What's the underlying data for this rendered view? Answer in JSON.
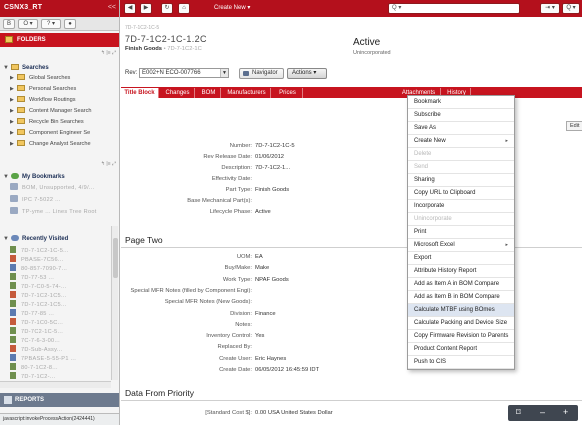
{
  "brand": {
    "name": "CSNX3_RT",
    "collapse": "<<"
  },
  "left_toolbar": {
    "btn1": "B",
    "btn2": "O ▾",
    "btn3": "? ▾",
    "btn4": "●"
  },
  "folders": {
    "label": "FOLDERS",
    "tools": "↰  |≡  ⤢"
  },
  "searches": {
    "title": "Searches",
    "items": [
      "Global Searches",
      "Personal Searches",
      "Workflow Routings",
      "Content Manager Search",
      "Recycle Bin Searches",
      "Component Engineer Se",
      "Change Analyst Searche"
    ],
    "tools": "↰  |≡  ⤢"
  },
  "bookmarks": {
    "title": "My Bookmarks",
    "items": [
      "BOM, Unsupported, 4/9/...",
      "IPC 7-5022 ...",
      "TP-yme ... Lines Tree Root"
    ]
  },
  "recent": {
    "title": "Recently Visited",
    "items": [
      "7D-7-1C2-1C-5...",
      "PBASE-7C56...",
      "80-857-7090-7...",
      "7D-77-53 ...",
      "7D-7-C0-5-74-...",
      "7D-7-1C2-1C5...",
      "7D-7-1C2-1C5...",
      "7D-77-85 ...",
      "7D-7-1C0-5C...",
      "7D-7C2-1C-5...",
      "7C-7-6-3-00...",
      "7D-Sub-Assy...",
      "7PBASE-5-55-P1 ...",
      "80-7-1C2-8...",
      "7D-7-1C2-..."
    ]
  },
  "reports": {
    "label": "REPORTS"
  },
  "status_url": "javascript:invokeProcessAction(2424441)",
  "topbar": {
    "back": "◀",
    "forward": "▶",
    "refresh": "↻",
    "home": "⌂",
    "create_new": "Create New ▾",
    "search_placeholder": "Q ▾",
    "btn_go": "⇥ ▾",
    "btn_adv": "Q ▾"
  },
  "object": {
    "number_header": "7D-7-1C2-1C-5",
    "name": "7D-7-1C2-1C-1.2C",
    "type_label": "Finish Goods",
    "type_suffix": "• 7D-7-1C2-1C",
    "state": "Active",
    "substate": "Unincorporated",
    "rev_label": "Rev:",
    "rev_value": "E002+N        ECO-007766",
    "navigator": "Navigator",
    "actions": "Actions ▾"
  },
  "tabs": [
    "Title Block",
    "Changes",
    "BOM",
    "Manufacturers",
    "Prices",
    "Attachments",
    "History"
  ],
  "edit_label": "Edit",
  "title_fields": [
    {
      "label": "Number:",
      "value": "7D-7-1C2-1C-5"
    },
    {
      "label": "Rev Release Date:",
      "value": "01/06/2012"
    },
    {
      "label": "Description:",
      "value": "7D-7-1C2-1..."
    },
    {
      "label": "Effectivity Date:",
      "value": ""
    },
    {
      "label": "Part Type:",
      "value": "Finish Goods"
    },
    {
      "label": "Base Mechanical Part(s):",
      "value": ""
    },
    {
      "label": "Lifecycle Phase:",
      "value": "Active"
    }
  ],
  "page_two": {
    "title": "Page Two",
    "fields": [
      {
        "label": "UOM:",
        "value": "EA"
      },
      {
        "label": "Buy/Make:",
        "value": "Make"
      },
      {
        "label": "Work Type:",
        "value": "NPAF Goods"
      },
      {
        "label": "Special MFR Notes (filled by Component Engi):",
        "value": ""
      },
      {
        "label": "Special MFR Notes (New Goods):",
        "value": ""
      },
      {
        "label": "Division:",
        "value": "Finance"
      },
      {
        "label": "Notes:",
        "value": ""
      },
      {
        "label": "Inventory Control:",
        "value": "Yes"
      },
      {
        "label": "Replaced By:",
        "value": ""
      },
      {
        "label": "Create User:",
        "value": "Eric Haynes"
      },
      {
        "label": "Create Date:",
        "value": "06/05/2012 16:45:59 IDT"
      }
    ]
  },
  "data_from_priority": {
    "title": "Data From Priority",
    "fields": [
      {
        "label": "[Standard Cost $]:",
        "value": "0.00 USA United States Dollar"
      }
    ]
  },
  "actions_menu": {
    "items": [
      {
        "label": "Bookmark",
        "disabled": false,
        "submenu": false
      },
      {
        "label": "Subscribe",
        "disabled": false,
        "submenu": false
      },
      {
        "label": "Save As",
        "disabled": false,
        "submenu": false
      },
      {
        "label": "Create New",
        "disabled": false,
        "submenu": true
      },
      {
        "label": "Delete",
        "disabled": true,
        "submenu": false
      },
      {
        "label": "Send",
        "disabled": true,
        "submenu": false
      },
      {
        "label": "Sharing",
        "disabled": false,
        "submenu": false
      },
      {
        "label": "Copy URL to Clipboard",
        "disabled": false,
        "submenu": false
      },
      {
        "label": "Incorporate",
        "disabled": false,
        "submenu": false
      },
      {
        "label": "Unincorporate",
        "disabled": true,
        "submenu": false
      },
      {
        "label": "Print",
        "disabled": false,
        "submenu": false
      },
      {
        "label": "Microsoft Excel",
        "disabled": false,
        "submenu": true
      },
      {
        "label": "Export",
        "disabled": false,
        "submenu": false
      },
      {
        "label": "Attribute History Report",
        "disabled": false,
        "submenu": false
      },
      {
        "label": "Add as Item A in BOM Compare",
        "disabled": false,
        "submenu": false
      },
      {
        "label": "Add as Item B in BOM Compare",
        "disabled": false,
        "submenu": false
      },
      {
        "label": "Calculate MTBF using BOmes",
        "disabled": false,
        "submenu": false,
        "highlighted": true
      },
      {
        "label": "Calculate Packing and Device Size",
        "disabled": false,
        "submenu": false
      },
      {
        "label": "Copy Firmware Revision to Parents",
        "disabled": false,
        "submenu": false
      },
      {
        "label": "Product Content Report",
        "disabled": false,
        "submenu": false
      },
      {
        "label": "Push to CIS",
        "disabled": false,
        "submenu": false
      }
    ]
  },
  "float_controls": {
    "a": "⌑",
    "b": "–",
    "c": "+"
  }
}
